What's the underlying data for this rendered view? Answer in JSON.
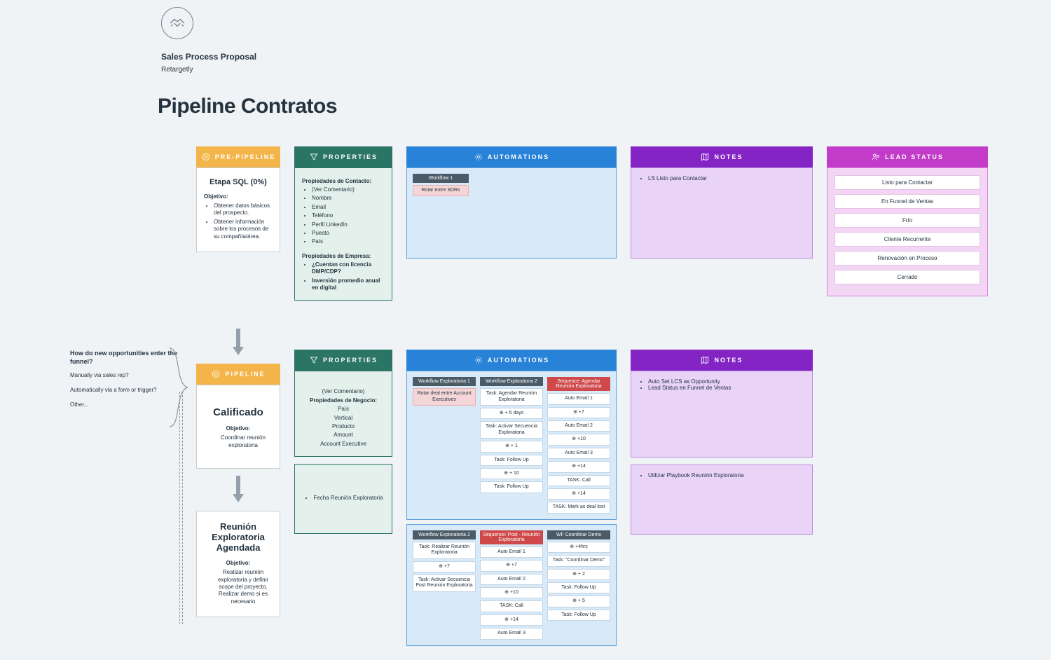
{
  "header": {
    "proposal_title": "Sales Process Proposal",
    "proposal_sub": "Retargetly"
  },
  "page_title": "Pipeline Contratos",
  "columns": {
    "prepipeline": "PRE-PIPELINE",
    "pipeline": "PIPELINE",
    "properties": "PROPERTIES",
    "automations": "AUTOMATIONS",
    "notes": "NOTES",
    "lead_status": "LEAD STATUS"
  },
  "row1": {
    "stage": {
      "title": "Etapa SQL (0%)",
      "obj_label": "Objetivo:",
      "bullets": [
        "Obtener datos básicos del prospecto.",
        "Obtener información sobre los procesos de su compañía/área."
      ]
    },
    "properties": {
      "sect1": "Propiedades de Contacto:",
      "list1": [
        "(Ver Comentario)",
        "Nombre",
        "Email",
        "Teléfono",
        "Perfil LinkedIn",
        "Puesto",
        "País"
      ],
      "sect2": "Propiedades de Empresa:",
      "list2": [
        "¿Cuentan con licencia DMP/CDP?",
        "Inversión promedio anual en digital"
      ]
    },
    "automations": {
      "wf1_head": "Workflow 1",
      "wf1_cell": "Rotar entre SDRs"
    },
    "notes": {
      "items": [
        "LS Listo para Contactar"
      ]
    },
    "lead_status": [
      "Listo para Contactar",
      "En Funnel de Ventas",
      "Frío",
      "Cliente Recurrente",
      "Renovación en Proceso",
      "Cerrado"
    ]
  },
  "side": {
    "q": "How do new opportunities enter the funnel?",
    "a1": "Manually via sales rep?",
    "a2": "Automatically via a form or trigger?",
    "a3": "Other..."
  },
  "row2": {
    "stage1": {
      "title": "Calificado",
      "obj_label": "Objetivo:",
      "bullets": [
        "Coordinar reunión exploratoria"
      ]
    },
    "stage2": {
      "title": "Reunión Exploratoria Agendada",
      "obj_label": "Objetivo:",
      "bullets": [
        "Realizar reunión exploratoria y definir scope del proyecto. Realizar demo si es necesario"
      ]
    },
    "properties1": {
      "line0": "(Ver Comentario)",
      "sect": "Propiedades de Negocio:",
      "list": [
        "País",
        "Vertical",
        "Producto",
        "Amount",
        "Account Executive"
      ]
    },
    "properties2": {
      "list": [
        "Fecha Reunión Exploratoria"
      ]
    },
    "automations1": {
      "cols": [
        {
          "head": "Workflow Exploratoria 1",
          "head_class": "dark",
          "cells": [
            {
              "t": "Rotar deal entre Account Executives",
              "c": "pink"
            }
          ]
        },
        {
          "head": "Workflow Exploratoria 2",
          "head_class": "dark",
          "cells": [
            {
              "t": "Task: Agendar Reunión Exploratoria"
            },
            {
              "t": "⊕ + 6 days"
            },
            {
              "t": "Task: Activar Secuencia Exploratoria"
            },
            {
              "t": "⊕ + 1"
            },
            {
              "t": "Task: Follow Up"
            },
            {
              "t": "⊕ + 10"
            },
            {
              "t": "Task: Follow Up"
            }
          ]
        },
        {
          "head": "Sequence: Agendar Reunión Exploratoria",
          "head_class": "red",
          "cells": [
            {
              "t": "Auto Email 1"
            },
            {
              "t": "⊕ +7"
            },
            {
              "t": "Auto Email 2"
            },
            {
              "t": "⊕ +10"
            },
            {
              "t": "Auto Email 3"
            },
            {
              "t": "⊕ +14"
            },
            {
              "t": "TASK: Call"
            },
            {
              "t": "⊕ +14"
            },
            {
              "t": "TASK: Mark as deal lost"
            }
          ]
        }
      ]
    },
    "automations2": {
      "cols": [
        {
          "head": "Workflow Exploratoria 2",
          "head_class": "dark",
          "cells": [
            {
              "t": "Task: Realizar Reunión Exploratoria"
            },
            {
              "t": "⊕ +7"
            },
            {
              "t": "Task: Activar Secuencia Post Reunión Exploratoria"
            }
          ]
        },
        {
          "head": "Sequence: Post - Reunión Exploratoria",
          "head_class": "red",
          "cells": [
            {
              "t": "Auto Email 1"
            },
            {
              "t": "⊕ +7"
            },
            {
              "t": "Auto Email 2"
            },
            {
              "t": "⊕ +10"
            },
            {
              "t": "TASK: Call"
            },
            {
              "t": "⊕ +14"
            },
            {
              "t": "Auto Email 3"
            }
          ]
        },
        {
          "head": "WF Coordinar Demo",
          "head_class": "dark",
          "cells": [
            {
              "t": "⊕ +4hrs"
            },
            {
              "t": "Task: \"Coordinar Demo\""
            },
            {
              "t": "⊕ + 2"
            },
            {
              "t": "Task: Follow Up"
            },
            {
              "t": "⊕ + 5"
            },
            {
              "t": "Task: Follow Up"
            }
          ]
        }
      ]
    },
    "notes1": {
      "items": [
        "Auto Set LCS as Opportunity",
        "Lead Status en Funnel de Ventas"
      ]
    },
    "notes2": {
      "items": [
        "Utilizar Playbook Reunión Exploratoria"
      ]
    }
  }
}
